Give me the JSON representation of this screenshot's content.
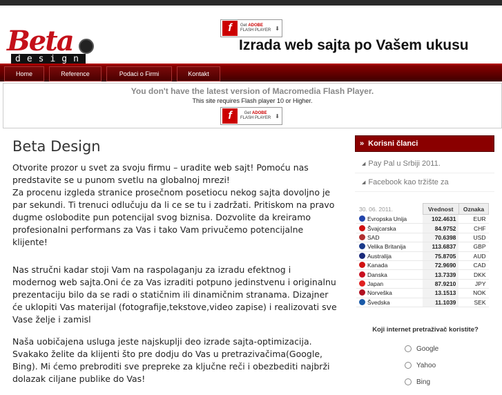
{
  "header": {
    "logo_top": "Beta",
    "logo_bottom": "design",
    "tagline": "Izrada web sajta po Vašem ukusu",
    "flash_badge": {
      "line1": "Get",
      "brand": "ADOBE",
      "line2": "FLASH PLAYER",
      "logo": "f"
    }
  },
  "nav": {
    "items": [
      "Home",
      "Reference",
      "Podaci o Firmi",
      "Kontakt"
    ]
  },
  "flash_notice": {
    "title": "You don't have the latest version of Macromedia Flash Player.",
    "subtitle": "This site requires Flash player 10 or Higher."
  },
  "main": {
    "title": "Beta Design",
    "paragraphs": [
      "Otvorite prozor u svet za svoju firmu – uradite web sajt! Pomoću nas predstavite se u punom svetlu na globalnoj mrezi!\nZa procenu izgleda stranice prosečnom posetiocu nekog sajta dovoljno je par sekundi. Ti trenuci odlučuju da li ce se tu i zadržati. Pritiskom na pravo dugme oslobodite pun potencijal svog biznisa. Dozvolite da kreiramo profesionalni performans za Vas i tako Vam privučemo potencijalne klijente!",
      "Nas stručni kadar stoji Vam na raspolaganju za izradu efektnog i modernog web sajta.Oni će za Vas izraditi potpuno jedinstvenu i originalnu prezentaciju bilo da se radi o statičnim ili dinamičnim stranama. Dizajner će uklopiti Vas materijal (fotografije,tekstove,video zapise) i realizovati sve Vase želje i zamisl",
      "Naša uobičajena usluga jeste najskuplji deo izrade sajta-optimizacija. Svakako želite da klijenti što pre dodju do Vas u pretrazivačima(Google, Bing). Mi ćemo prebroditi sve prepreke za ključne reči i obezbediti najbrži dolazak ciljane publike do Vas!"
    ]
  },
  "sidebar": {
    "articles_title": "Korisni članci",
    "articles": [
      "Pay Pal u Srbiji 2011.",
      "Facebook kao tržište za"
    ],
    "rates": {
      "date": "30. 06. 2011.",
      "col_value": "Vrednost",
      "col_code": "Oznaka",
      "rows": [
        {
          "name": "Evropska Unija",
          "value": "102.4631",
          "code": "EUR",
          "flag": "#2244aa"
        },
        {
          "name": "Švajcarska",
          "value": "84.9752",
          "code": "CHF",
          "flag": "#d01010"
        },
        {
          "name": "SAD",
          "value": "70.6398",
          "code": "USD",
          "flag": "#b03030"
        },
        {
          "name": "Velika Britanija",
          "value": "113.6837",
          "code": "GBP",
          "flag": "#1a3a8a"
        },
        {
          "name": "Australija",
          "value": "75.8705",
          "code": "AUD",
          "flag": "#1a2a7a"
        },
        {
          "name": "Kanada",
          "value": "72.9690",
          "code": "CAD",
          "flag": "#d01010"
        },
        {
          "name": "Danska",
          "value": "13.7339",
          "code": "DKK",
          "flag": "#c81020"
        },
        {
          "name": "Japan",
          "value": "87.9210",
          "code": "JPY",
          "flag": "#e02020"
        },
        {
          "name": "Norveška",
          "value": "13.1513",
          "code": "NOK",
          "flag": "#b01020"
        },
        {
          "name": "Švedska",
          "value": "11.1039",
          "code": "SEK",
          "flag": "#1a5aa8"
        }
      ]
    },
    "poll": {
      "question": "Koji internet pretraživač koristite?",
      "options": [
        "Google",
        "Yahoo",
        "Bing"
      ]
    }
  },
  "colors": {
    "brand_red": "#8a0000",
    "logo_red": "#c4101a"
  }
}
